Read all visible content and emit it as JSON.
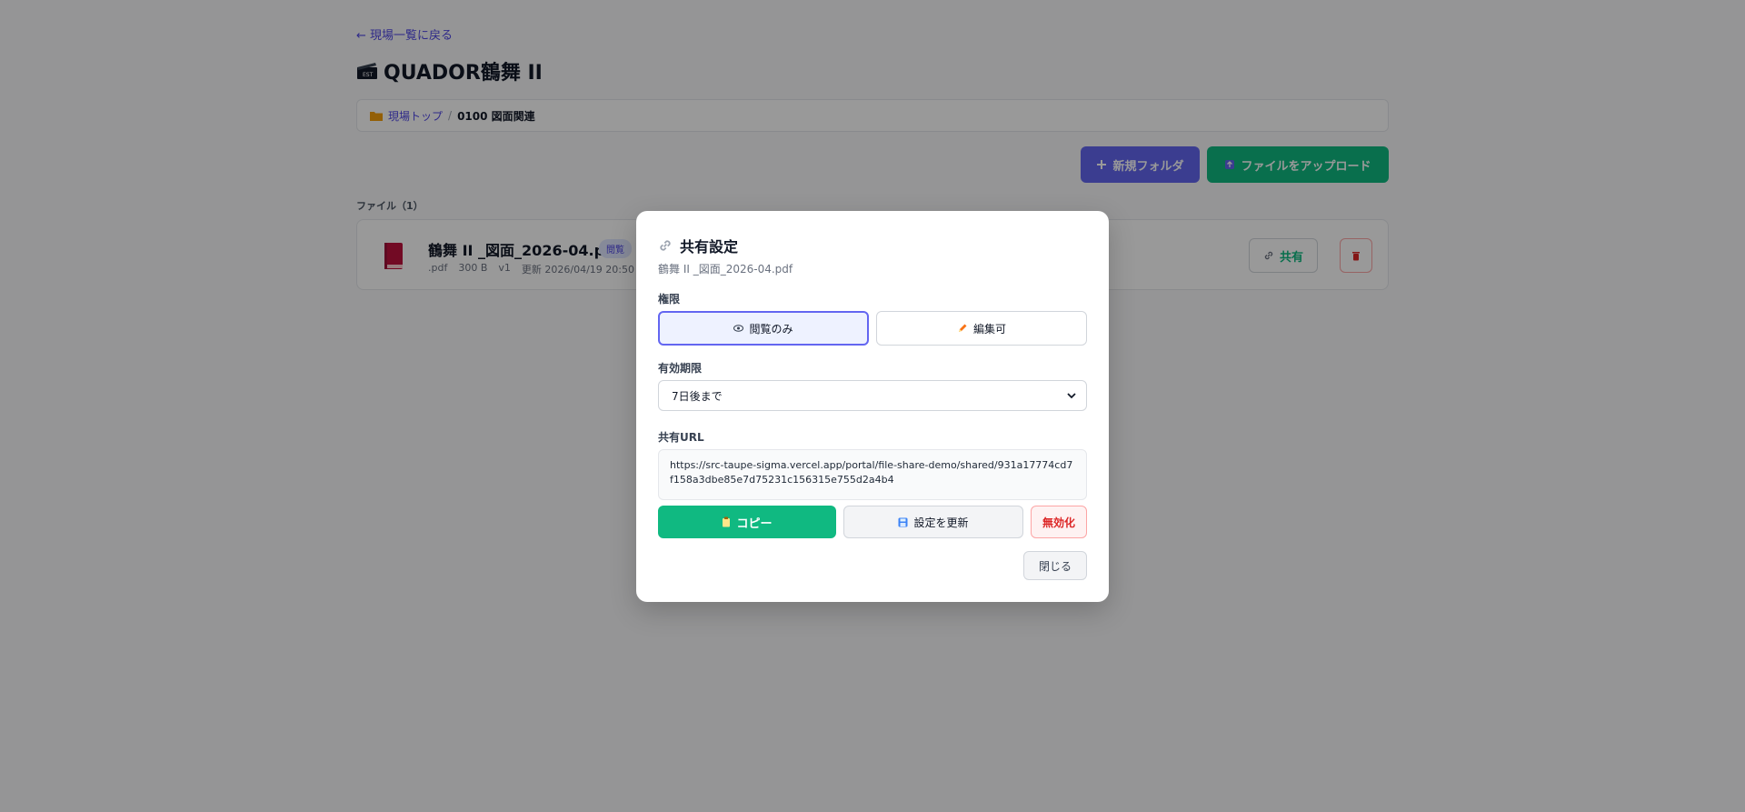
{
  "nav": {
    "back_label": "← 現場一覧に戻る"
  },
  "site": {
    "title": "QUADOR鶴舞 II"
  },
  "breadcrumb": {
    "root": "現場トップ",
    "separator": "/",
    "current": "0100 図面関連"
  },
  "toolbar": {
    "new_folder_label": "新規フォルダ",
    "upload_label": "ファイルをアップロード"
  },
  "files": {
    "section_label": "ファイル（1）",
    "items": [
      {
        "name": "鶴舞 II _図面_2026-04.pdf",
        "badge": "閲覧",
        "ext": ".pdf",
        "size": "300 B",
        "version": "v1",
        "updated": "更新 2026/04/19 20:50",
        "share_label": "共有"
      }
    ]
  },
  "modal": {
    "title": "共有設定",
    "subtitle": "鶴舞 II _図面_2026-04.pdf",
    "permission_label": "権限",
    "perm_view": "閲覧のみ",
    "perm_edit": "編集可",
    "expiry_label": "有効期限",
    "expiry_value": "7日後まで",
    "url_label": "共有URL",
    "url": "https://src-taupe-sigma.vercel.app/portal/file-share-demo/shared/931a17774cd7f158a3dbe85e7d75231c156315e755d2a4b4",
    "copy_label": "コピー",
    "update_label": "設定を更新",
    "disable_label": "無効化",
    "close_label": "閉じる"
  },
  "colors": {
    "primary": "#6366f1",
    "success": "#10b981",
    "danger": "#dc2626",
    "overlay": "rgba(0,0,0,0.4)"
  }
}
